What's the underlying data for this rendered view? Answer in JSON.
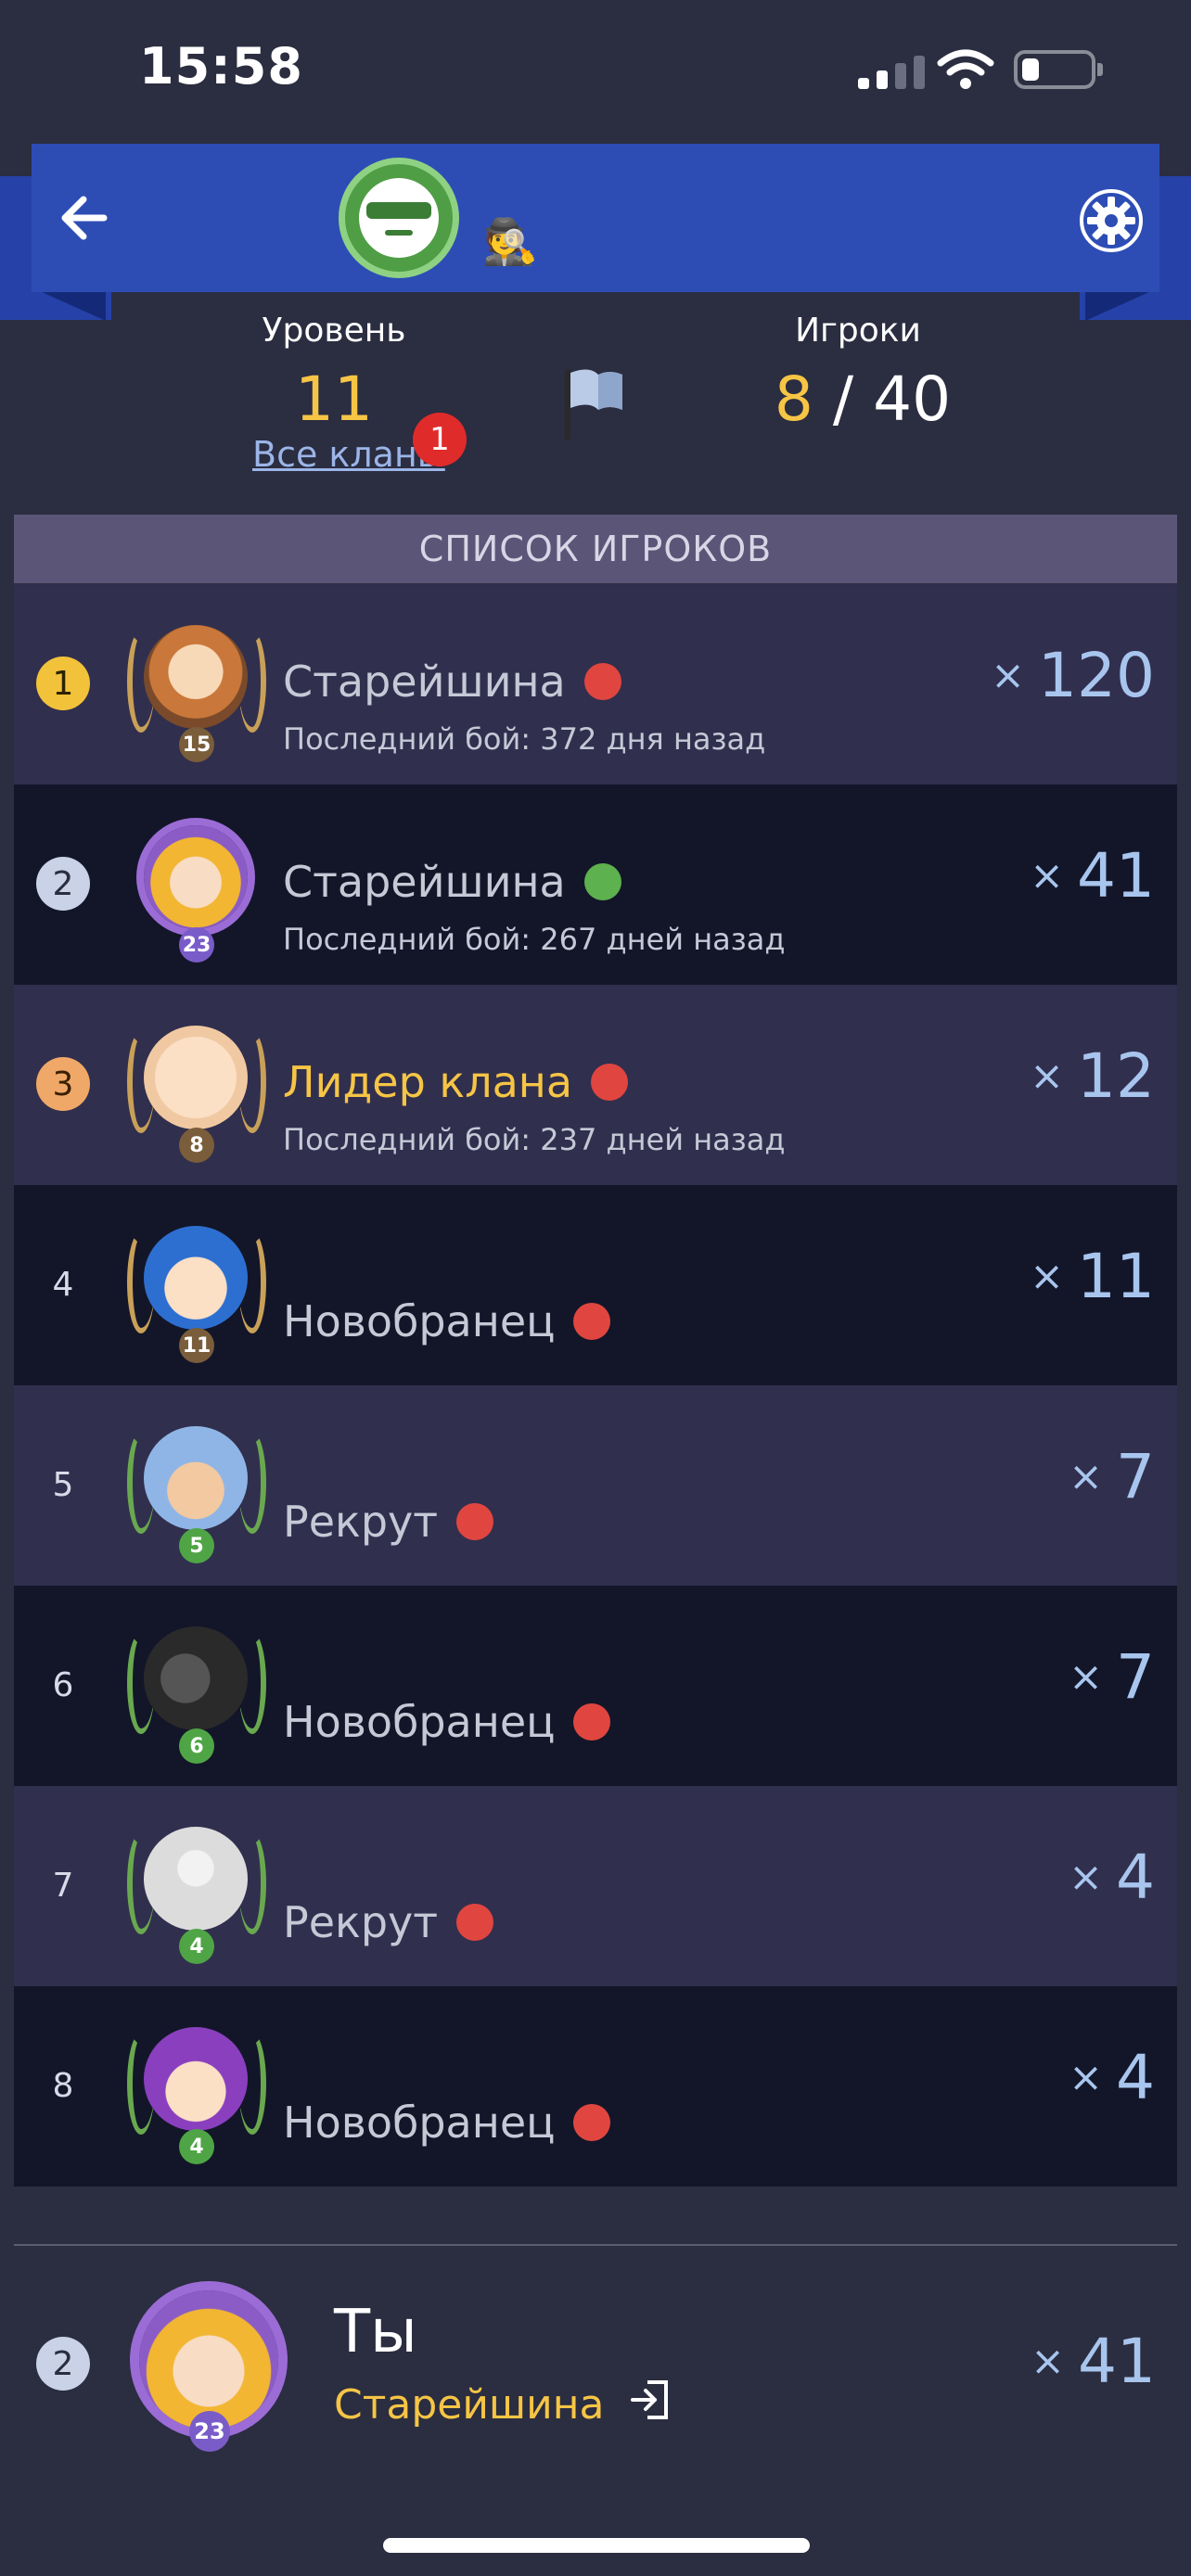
{
  "status_bar": {
    "time": "15:58"
  },
  "header": {
    "spy_icon": "🕵",
    "back_icon": "arrow-left",
    "settings_icon": "gear"
  },
  "clan": {
    "level_label": "Уровень",
    "level_value": "11",
    "all_clans_link": "Все кланы",
    "all_clans_badge": "1",
    "players_label": "Игроки",
    "players_current": "8",
    "players_max": "/ 40"
  },
  "list": {
    "header": "СПИСОК ИГРОКОВ",
    "rows": [
      {
        "rank": "1",
        "role": "Старейшина",
        "status": "red",
        "last_battle": "Последний бой: 372 дня назад",
        "score": "120",
        "avatar_level": "15"
      },
      {
        "rank": "2",
        "role": "Старейшина",
        "status": "green",
        "last_battle": "Последний бой: 267 дней назад",
        "score": "41",
        "avatar_level": "23"
      },
      {
        "rank": "3",
        "role": "Лидер клана",
        "status": "red",
        "last_battle": "Последний бой: 237 дней назад",
        "score": "12",
        "avatar_level": "8"
      },
      {
        "rank": "4",
        "role": "Новобранец",
        "status": "red",
        "last_battle": "",
        "score": "11",
        "avatar_level": "11"
      },
      {
        "rank": "5",
        "role": "Рекрут",
        "status": "red",
        "last_battle": "",
        "score": "7",
        "avatar_level": "5"
      },
      {
        "rank": "6",
        "role": "Новобранец",
        "status": "red",
        "last_battle": "",
        "score": "7",
        "avatar_level": "6"
      },
      {
        "rank": "7",
        "role": "Рекрут",
        "status": "red",
        "last_battle": "",
        "score": "4",
        "avatar_level": "4"
      },
      {
        "rank": "8",
        "role": "Новобранец",
        "status": "red",
        "last_battle": "",
        "score": "4",
        "avatar_level": "4"
      }
    ]
  },
  "self": {
    "rank": "2",
    "name": "Ты",
    "role": "Старейшина",
    "score": "41",
    "avatar_level": "23"
  },
  "score_prefix": "×",
  "colors": {
    "accent_gold": "#f6c545",
    "header_blue": "#2d4db5",
    "status_red": "#e0463f",
    "status_green": "#5db14e"
  }
}
